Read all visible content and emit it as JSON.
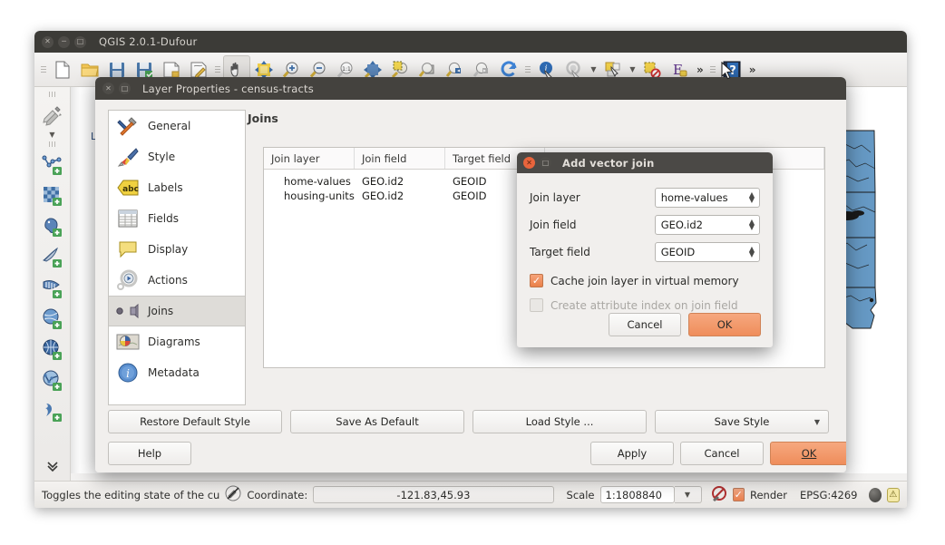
{
  "app": {
    "title": "QGIS 2.0.1-Dufour",
    "window_buttons": [
      "close",
      "minimize",
      "maximize"
    ]
  },
  "toolbar": {
    "items": [
      {
        "name": "new-project-icon",
        "label": "New Project"
      },
      {
        "name": "open-project-icon",
        "label": "Open Project"
      },
      {
        "name": "save-project-icon",
        "label": "Save Project"
      },
      {
        "name": "save-project-as-icon",
        "label": "Save Project As"
      },
      {
        "name": "new-print-composer-icon",
        "label": "New Print Composer"
      },
      {
        "name": "composer-manager-icon",
        "label": "Composer Manager"
      },
      {
        "name": "pan-map-icon",
        "label": "Pan Map"
      },
      {
        "name": "pan-to-selection-icon",
        "label": "Pan Map to Selection"
      },
      {
        "name": "zoom-in-icon",
        "label": "Zoom In"
      },
      {
        "name": "zoom-out-icon",
        "label": "Zoom Out"
      },
      {
        "name": "zoom-native-icon",
        "label": "Zoom to Native Resolution"
      },
      {
        "name": "zoom-full-icon",
        "label": "Zoom Full"
      },
      {
        "name": "zoom-to-selection-icon",
        "label": "Zoom to Selection"
      },
      {
        "name": "zoom-to-layer-icon",
        "label": "Zoom to Layer"
      },
      {
        "name": "zoom-last-icon",
        "label": "Zoom Last"
      },
      {
        "name": "zoom-next-icon",
        "label": "Zoom Next"
      },
      {
        "name": "refresh-icon",
        "label": "Refresh"
      },
      {
        "name": "identify-features-icon",
        "label": "Identify Features"
      },
      {
        "name": "run-feature-action-icon",
        "label": "Run Feature Action"
      },
      {
        "name": "select-features-icon",
        "label": "Select Features"
      },
      {
        "name": "deselect-features-icon",
        "label": "Deselect Features"
      },
      {
        "name": "measure-icon",
        "label": "Measure"
      },
      {
        "name": "overflow-icon",
        "label": "More"
      },
      {
        "name": "help-icon",
        "label": "Help"
      },
      {
        "name": "overflow-right-icon",
        "label": "More"
      }
    ],
    "overflow_glyph": "»"
  },
  "left_toolbar": {
    "items": [
      {
        "name": "pencil-toggle-editing-icon",
        "label": "Toggle Editing"
      },
      {
        "name": "add-vector-layer-icon",
        "label": "Add Vector Layer"
      },
      {
        "name": "add-raster-layer-icon",
        "label": "Add Raster Layer"
      },
      {
        "name": "add-postgis-layer-icon",
        "label": "Add PostGIS Layer"
      },
      {
        "name": "add-spatialite-layer-icon",
        "label": "Add SpatiaLite Layer"
      },
      {
        "name": "add-mssql-layer-icon",
        "label": "Add MSSQL Spatial Layer"
      },
      {
        "name": "add-wms-layer-icon",
        "label": "Add WMS/WMTS Layer"
      },
      {
        "name": "add-wcs-layer-icon",
        "label": "Add WCS Layer"
      },
      {
        "name": "add-wfs-layer-icon",
        "label": "Add WFS Layer"
      },
      {
        "name": "add-delimited-text-layer-icon",
        "label": "Add Delimited Text Layer"
      },
      {
        "name": "expand-more-icon",
        "label": "More"
      }
    ]
  },
  "panels": {
    "layers_panel_label": "L"
  },
  "layer_properties": {
    "title": "Layer Properties - census-tracts",
    "page_title": "Joins",
    "sidebar": [
      {
        "label": "General",
        "icon": "general-icon",
        "selected": false
      },
      {
        "label": "Style",
        "icon": "style-icon",
        "selected": false
      },
      {
        "label": "Labels",
        "icon": "labels-icon",
        "selected": false
      },
      {
        "label": "Fields",
        "icon": "fields-icon",
        "selected": false
      },
      {
        "label": "Display",
        "icon": "display-icon",
        "selected": false
      },
      {
        "label": "Actions",
        "icon": "actions-icon",
        "selected": false
      },
      {
        "label": "Joins",
        "icon": "joins-icon",
        "selected": true
      },
      {
        "label": "Diagrams",
        "icon": "diagrams-icon",
        "selected": false
      },
      {
        "label": "Metadata",
        "icon": "metadata-icon",
        "selected": false
      }
    ],
    "joins_table": {
      "columns": [
        "Join layer",
        "Join field",
        "Target field",
        ""
      ],
      "rows": [
        [
          "home-values",
          "GEO.id2",
          "GEOID",
          ""
        ],
        [
          "housing-units",
          "GEO.id2",
          "GEOID",
          ""
        ]
      ]
    },
    "row_buttons": [
      {
        "name": "add-join-button",
        "glyph": "+"
      },
      {
        "name": "remove-join-button",
        "glyph": "–"
      }
    ],
    "style_buttons": [
      {
        "label": "Restore Default Style",
        "name": "restore-default-style-button",
        "dropdown": false
      },
      {
        "label": "Save As Default",
        "name": "save-as-default-button",
        "dropdown": false
      },
      {
        "label": "Load Style ...",
        "name": "load-style-button",
        "dropdown": false
      },
      {
        "label": "Save Style",
        "name": "save-style-button",
        "dropdown": true
      }
    ],
    "bottom_buttons": {
      "help": "Help",
      "apply": "Apply",
      "cancel": "Cancel",
      "ok": "OK"
    }
  },
  "add_vector_join": {
    "title": "Add vector join",
    "fields": [
      {
        "label": "Join layer",
        "value": "home-values",
        "name": "join-layer-combo"
      },
      {
        "label": "Join field",
        "value": "GEO.id2",
        "name": "join-field-combo"
      },
      {
        "label": "Target field",
        "value": "GEOID",
        "name": "target-field-combo"
      }
    ],
    "checkboxes": [
      {
        "label": "Cache join layer in virtual memory",
        "checked": true,
        "enabled": true,
        "name": "cache-join-layer-checkbox"
      },
      {
        "label": "Create attribute index on join field",
        "checked": false,
        "enabled": false,
        "name": "create-attribute-index-checkbox"
      }
    ],
    "buttons": {
      "cancel": "Cancel",
      "ok": "OK"
    }
  },
  "status_bar": {
    "message": "Toggles the editing state of the cu",
    "coordinate_label": "Coordinate:",
    "coordinate_value": "-121.83,45.93",
    "scale_label": "Scale",
    "scale_value": "1:1808840",
    "render_label": "Render",
    "render_checked": true,
    "crs_label": "EPSG:4269"
  },
  "colors": {
    "accent_orange": "#ef8d5b",
    "titlebar_dark": "#3c3b37",
    "dialog_bg": "#f1efed",
    "map_fill": "#6699c4",
    "selection_row": "#dedcd8"
  }
}
